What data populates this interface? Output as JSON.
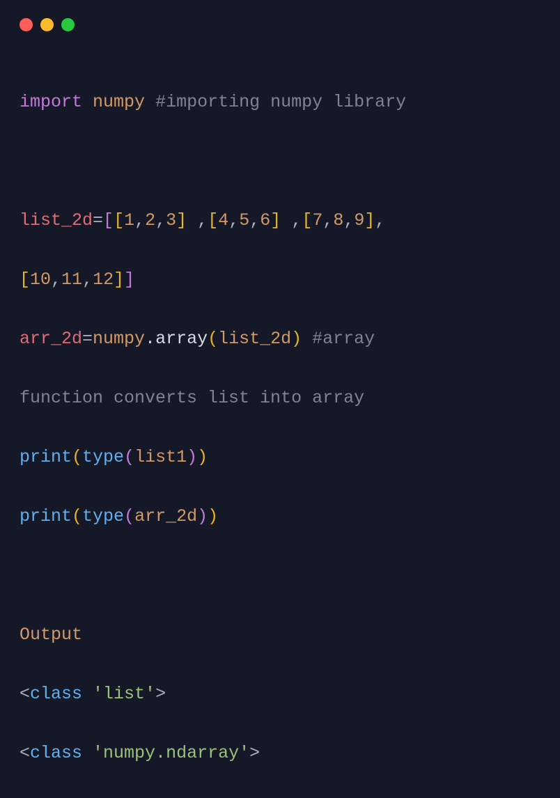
{
  "window": {
    "controls": [
      "close",
      "minimize",
      "maximize"
    ]
  },
  "code": {
    "line1": {
      "import_kw": "import",
      "module": "numpy",
      "comment": "#importing numpy library"
    },
    "line3a": {
      "var": "list_2d",
      "eq": "=",
      "b_open1": "[",
      "b_open2": "[",
      "n1": "1",
      "c1": ",",
      "n2": "2",
      "c2": ",",
      "n3": "3",
      "b_close2": "]",
      "sp1": " ,",
      "b_open3": "[",
      "n4": "4",
      "c3": ",",
      "n5": "5",
      "c4": ",",
      "n6": "6",
      "b_close3": "]",
      "sp2": " ,",
      "b_open4": "[",
      "n7": "7",
      "c5": ",",
      "n8": "8",
      "c6": ",",
      "n9": "9",
      "b_close4": "]",
      "c7": ","
    },
    "line3b": {
      "b_open5": "[",
      "n10": "10",
      "c8": ",",
      "n11": "11",
      "c9": ",",
      "n12": "12",
      "b_close5": "]",
      "b_close1": "]"
    },
    "line4": {
      "var": "arr_2d",
      "eq": "=",
      "mod": "numpy",
      "dot": ".",
      "func": "array",
      "p_open": "(",
      "arg": "list_2d",
      "p_close": ")",
      "sp": " ",
      "comment1": "#array "
    },
    "line4b": {
      "comment2": "function converts list into array"
    },
    "line5": {
      "func": "print",
      "p_open": "(",
      "type_fn": "type",
      "p2_open": "(",
      "arg": "list1",
      "p2_close": ")",
      "p_close": ")"
    },
    "line6": {
      "func": "print",
      "p_open": "(",
      "type_fn": "type",
      "p2_open": "(",
      "arg": "arr_2d",
      "p2_close": ")",
      "p_close": ")"
    },
    "output_label": "Output",
    "output1": {
      "lt": "<",
      "cls": "class",
      "sp": " ",
      "str": "'list'",
      "gt": ">"
    },
    "output2": {
      "lt": "<",
      "cls": "class",
      "sp": " ",
      "str": "'numpy.ndarray'",
      "gt": ">"
    }
  }
}
